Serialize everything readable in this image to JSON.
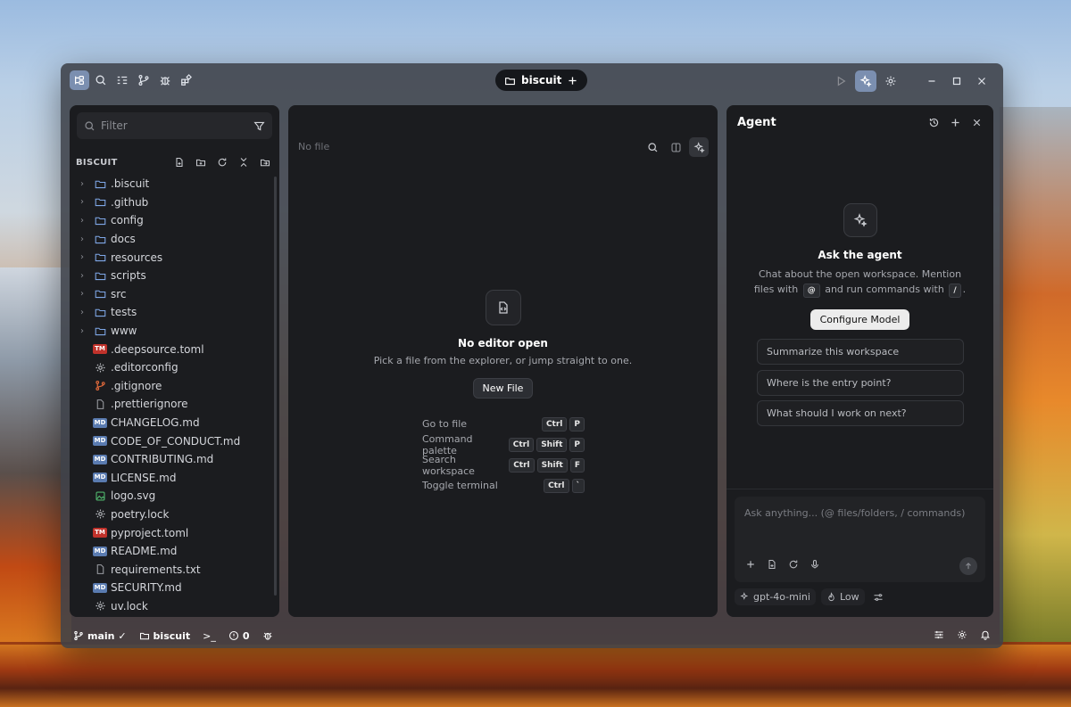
{
  "window": {
    "workspace_tab": "biscuit",
    "titlebar_left_icons": [
      "explorer-icon",
      "search-icon",
      "outline-icon",
      "source-control-icon",
      "debug-icon",
      "extensions-icon"
    ],
    "titlebar_right_icons": [
      "run-icon",
      "agent-icon",
      "settings-icon",
      "minimize-icon",
      "maximize-icon",
      "close-icon"
    ]
  },
  "explorer": {
    "filter_placeholder": "Filter",
    "section_title": "BISCUIT",
    "folders": [
      ".biscuit",
      ".github",
      "config",
      "docs",
      "resources",
      "scripts",
      "src",
      "tests",
      "www"
    ],
    "files": [
      {
        "name": ".deepsource.toml",
        "icon": "tm"
      },
      {
        "name": ".editorconfig",
        "icon": "gear"
      },
      {
        "name": ".gitignore",
        "icon": "git"
      },
      {
        "name": ".prettierignore",
        "icon": "file"
      },
      {
        "name": "CHANGELOG.md",
        "icon": "md"
      },
      {
        "name": "CODE_OF_CONDUCT.md",
        "icon": "md"
      },
      {
        "name": "CONTRIBUTING.md",
        "icon": "md"
      },
      {
        "name": "LICENSE.md",
        "icon": "md"
      },
      {
        "name": "logo.svg",
        "icon": "image"
      },
      {
        "name": "poetry.lock",
        "icon": "gear"
      },
      {
        "name": "pyproject.toml",
        "icon": "tm"
      },
      {
        "name": "README.md",
        "icon": "md"
      },
      {
        "name": "requirements.txt",
        "icon": "file"
      },
      {
        "name": "SECURITY.md",
        "icon": "md"
      },
      {
        "name": "uv.lock",
        "icon": "gear"
      }
    ],
    "badge_labels": {
      "tm": "TM",
      "md": "MD"
    }
  },
  "editor": {
    "no_file": "No file",
    "empty_title": "No editor open",
    "empty_subtitle": "Pick a file from the explorer, or jump straight to one.",
    "new_file": "New File",
    "shortcuts": [
      {
        "label": "Go to file",
        "keys": [
          "Ctrl",
          "P"
        ]
      },
      {
        "label": "Command palette",
        "keys": [
          "Ctrl",
          "Shift",
          "P"
        ]
      },
      {
        "label": "Search workspace",
        "keys": [
          "Ctrl",
          "Shift",
          "F"
        ]
      },
      {
        "label": "Toggle terminal",
        "keys": [
          "Ctrl",
          "`"
        ]
      }
    ]
  },
  "agent": {
    "title": "Agent",
    "empty_title": "Ask the agent",
    "desc_1": "Chat about the open workspace. Mention files with",
    "desc_at": "@",
    "desc_2": "and run commands with",
    "desc_slash": "/",
    "desc_end": ".",
    "configure": "Configure Model",
    "suggestions": [
      "Summarize this workspace",
      "Where is the entry point?",
      "What should I work on next?"
    ],
    "input_placeholder": "Ask anything... (@ files/folders, / commands)",
    "model": "gpt-4o-mini",
    "effort": "Low"
  },
  "status": {
    "branch": "main ✓",
    "workspace": "biscuit",
    "terminal": ">_",
    "problems": "0"
  }
}
